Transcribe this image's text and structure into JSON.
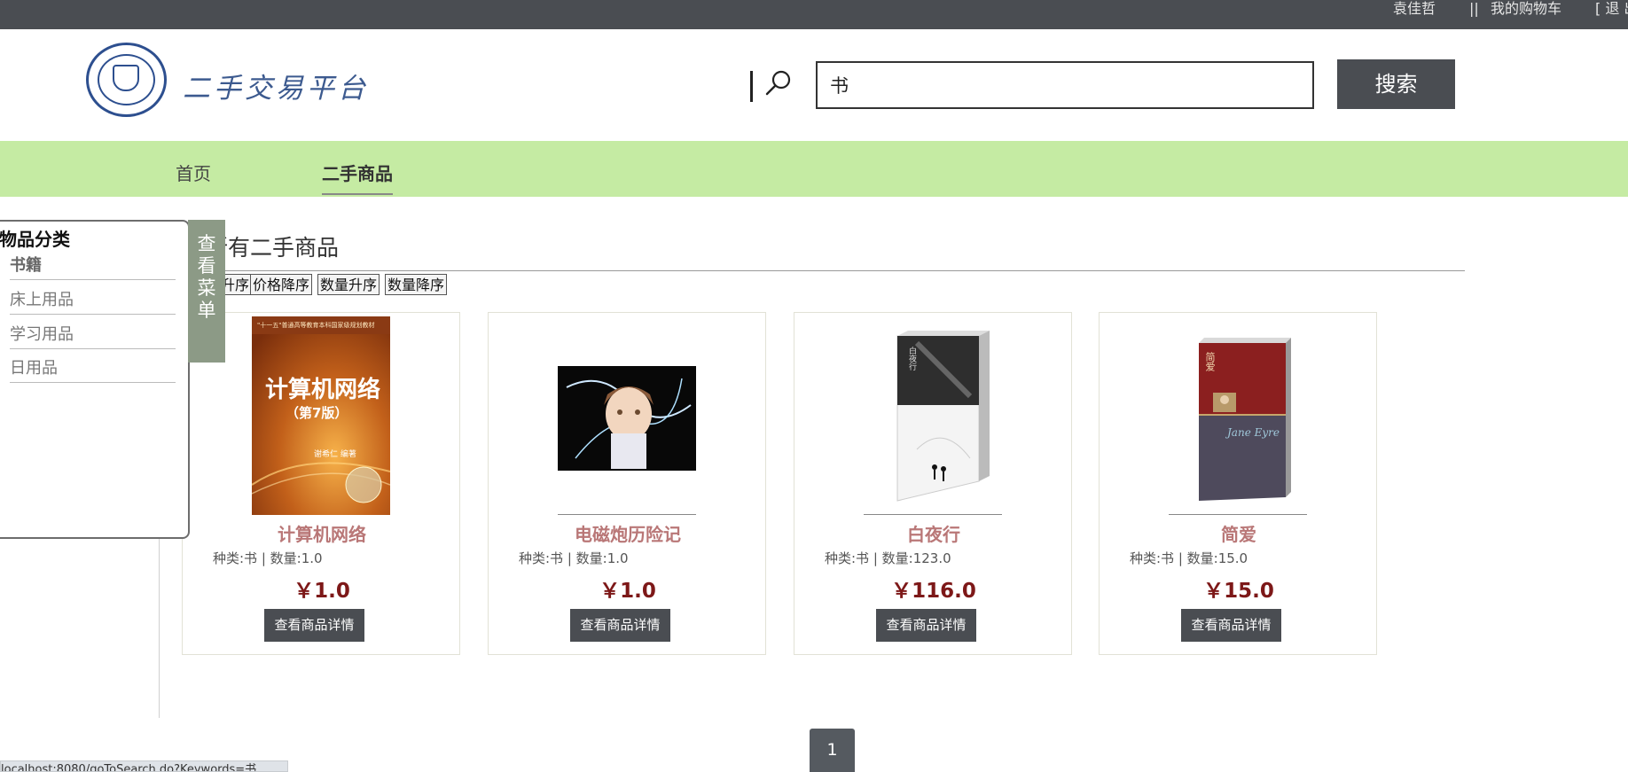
{
  "topbar": {
    "username": "袁佳哲",
    "separator": "||",
    "cart": "我的购物车",
    "logout": "[ 退 出"
  },
  "header": {
    "logo_text": "二手交易平台",
    "search_value": "书",
    "search_button": "搜索"
  },
  "nav": {
    "items": [
      {
        "label": "首页"
      },
      {
        "label": "二手商品"
      }
    ]
  },
  "sidebar": {
    "title": "物品分类",
    "categories": [
      {
        "label": "书籍"
      },
      {
        "label": "床上用品"
      },
      {
        "label": "学习用品"
      },
      {
        "label": "日用品"
      }
    ],
    "toggle": [
      "查",
      "看",
      "菜",
      "单"
    ]
  },
  "main": {
    "title": "所有二手商品",
    "sort_buttons": [
      {
        "label": "价格升序"
      },
      {
        "label": "价格降序"
      },
      {
        "label": "数量升序"
      },
      {
        "label": "数量降序"
      }
    ],
    "products": [
      {
        "name": "计算机网络",
        "meta": "种类:书 | 数量:1.0",
        "price": "￥1.0",
        "button": "查看商品详情",
        "cover_title": "计算机网络",
        "cover_edition": "（第7版）",
        "cover_author": "谢希仁  编著",
        "cover_series": "\"十一五\"普通高等教育本科国家级规划教材"
      },
      {
        "name": "电磁炮历险记",
        "meta": "种类:书 | 数量:1.0",
        "price": "￥1.0",
        "button": "查看商品详情"
      },
      {
        "name": "白夜行",
        "meta": "种类:书 | 数量:123.0",
        "price": "￥116.0",
        "button": "查看商品详情",
        "cover_title": "白夜行"
      },
      {
        "name": "简爱",
        "meta": "种类:书 | 数量:15.0",
        "price": "￥15.0",
        "button": "查看商品详情",
        "cover_title": "简爱",
        "cover_subtitle": "Jane Eyre"
      }
    ]
  },
  "pagination": {
    "current": "1"
  },
  "status_bar": {
    "url": "localhost:8080/goToSearch.do?Keywords=书"
  },
  "colors": {
    "topbar": "#4a4d52",
    "nav": "#c5eba3",
    "product_name": "#b97777",
    "price": "#7d1818",
    "menu_toggle": "#8c9a86"
  }
}
